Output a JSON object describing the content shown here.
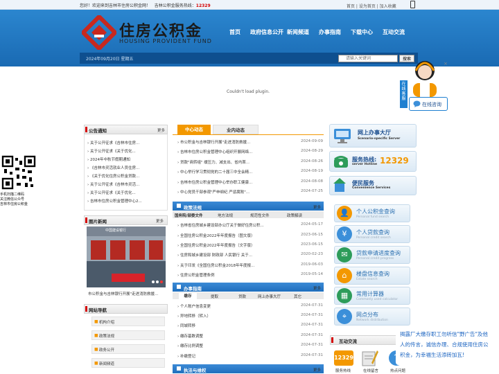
{
  "topbar": {
    "welcome": "您好！欢迎来到吉林市住房公积金网！",
    "hotline_label": "吉林公积金服务热线：",
    "hotline_number": "12329",
    "links": "首页  |  设为首页  |  加入收藏"
  },
  "header": {
    "logo_cn": "住房公积金",
    "logo_en": "HOUSING PROVIDENT FUND",
    "nav": [
      "首页",
      "政府信息公开",
      "新闻频道",
      "办事指南",
      "下载中心",
      "互动交流"
    ]
  },
  "datebar": {
    "date": "2024年09月20日 星期五",
    "search_placeholder": "请输入关键词",
    "search_button": "搜索"
  },
  "plugin": {
    "message": "Couldn't load plugin."
  },
  "qr": {
    "caption": [
      "手机扫描二维码",
      "关注微信公众号",
      "吉林市住房公积金"
    ]
  },
  "consult": {
    "tab": "在线客服",
    "label": "在线咨询",
    "close": "×"
  },
  "announce": {
    "title": "公告通知",
    "more": "更多",
    "items": [
      "关于公开征求《吉林市住房...",
      "关于公开征求《关于优化...",
      "2024年中秋节假期通知",
      "《吉林市灵活就业人员住房...",
      "《关于优化住房公积金贷款...",
      "关于公开征求《吉林市灵活...",
      "关于公开征求《关于优化...",
      "吉林市住房公积金管理中心2..."
    ]
  },
  "photo_news": {
    "title": "图片新闻",
    "more": "更多",
    "caption": "市公积金与吉林银行开展\"走进消防救援...",
    "banner": "中国建设银行"
  },
  "site_nav": {
    "title": "网站导航",
    "items": [
      "机构介绍",
      "政策法规",
      "政务公开",
      "新闻频道"
    ]
  },
  "center_news": {
    "tabs": [
      "中心动态",
      "业内动态"
    ],
    "items": [
      {
        "title": "市公积金与吉林银行开展\"走进消防救援...",
        "date": "2024-09-09"
      },
      {
        "title": "吉林市住房公积金管理中心组织开展网络...",
        "date": "2024-08-29"
      },
      {
        "title": "贷款\"商转组\" 缓压力、减支出、省内首...",
        "date": "2024-08-26"
      },
      {
        "title": "中心举行学习贯彻党的二十届三中全会精...",
        "date": "2024-08-19"
      },
      {
        "title": "吉林市住房公积金管理中心举办职工健康...",
        "date": "2024-08-08"
      },
      {
        "title": "中心党员干部参观\"严申纲纪 严惩腐败\"...",
        "date": "2024-07-25"
      }
    ]
  },
  "policy": {
    "title": "政策法规",
    "more": "更多",
    "subtabs": [
      "国务院/部委文件",
      "地方法规",
      "规范性文件",
      "政策解读"
    ],
    "items": [
      {
        "title": "吉林省住房城乡建设部办公厅关于做好住房公积...",
        "date": "2024-05-17"
      },
      {
        "title": "全国住房公积金2022年年度报告（图文版）",
        "date": "2023-06-15"
      },
      {
        "title": "全国住房公积金2022年年度报告（文字版）",
        "date": "2023-06-15"
      },
      {
        "title": "住房和城乡建设部 财政部 人民银行 关于...",
        "date": "2020-02-23"
      },
      {
        "title": "关于印发《全国住房公积金2018年年度报...",
        "date": "2019-06-03"
      },
      {
        "title": "住房公积金管理条例",
        "date": "2019-05-14"
      }
    ]
  },
  "guide": {
    "title": "办事指南",
    "more": "更多",
    "subtabs": [
      "缴存",
      "提取",
      "贷款",
      "网上办事大厅",
      "其它"
    ],
    "items": [
      {
        "title": "个人账户信息变更",
        "date": "2024-07-31"
      },
      {
        "title": "异地转移（转入）",
        "date": "2024-07-31"
      },
      {
        "title": "同城转移",
        "date": "2024-07-31"
      },
      {
        "title": "缴存基数调整",
        "date": "2024-07-31"
      },
      {
        "title": "缴存比例调整",
        "date": "2024-07-31"
      },
      {
        "title": "补缴登记",
        "date": "2024-07-31"
      }
    ]
  },
  "law": {
    "title": "执法与维权",
    "more": "更多"
  },
  "right": {
    "online_hall": {
      "title": "网上办事大厅",
      "sub": "Scenario-specific Server"
    },
    "hotline": {
      "title": "服务热线:",
      "sub": "server Hotline",
      "number": "12329"
    },
    "convenience": {
      "title": "便民服务",
      "sub": "Convenience Services"
    },
    "services": [
      {
        "title": "个人公积金查询",
        "sub": "Personal fund search",
        "icon": "👤"
      },
      {
        "title": "个人贷款查询",
        "sub": "Personal credit search",
        "icon": "¥"
      },
      {
        "title": "贷款申请进度查询",
        "sub": "Personal credit progress",
        "icon": "✉"
      },
      {
        "title": "楼盘信息查询",
        "sub": "Estate search",
        "icon": "⌂"
      },
      {
        "title": "常用计算器",
        "sub": "Commonly used calculator",
        "icon": "▦"
      },
      {
        "title": "网点分布",
        "sub": "Network distribution",
        "icon": "⌖"
      }
    ],
    "interact": {
      "title": "互动交流",
      "icons": [
        "服务热线",
        "在线留言",
        "热点问题"
      ],
      "hotline_number": "12329"
    }
  },
  "notice": {
    "text": "揭露厂大缴存职工勿听信\"野广告\"及他人的传言，诚信办理、合规使用住房公积金，为幸福生活添砖加瓦!"
  },
  "colors": {
    "header_blue": "#1a6ab3",
    "accent_orange": "#f39800",
    "hotline_red": "#d40000"
  }
}
